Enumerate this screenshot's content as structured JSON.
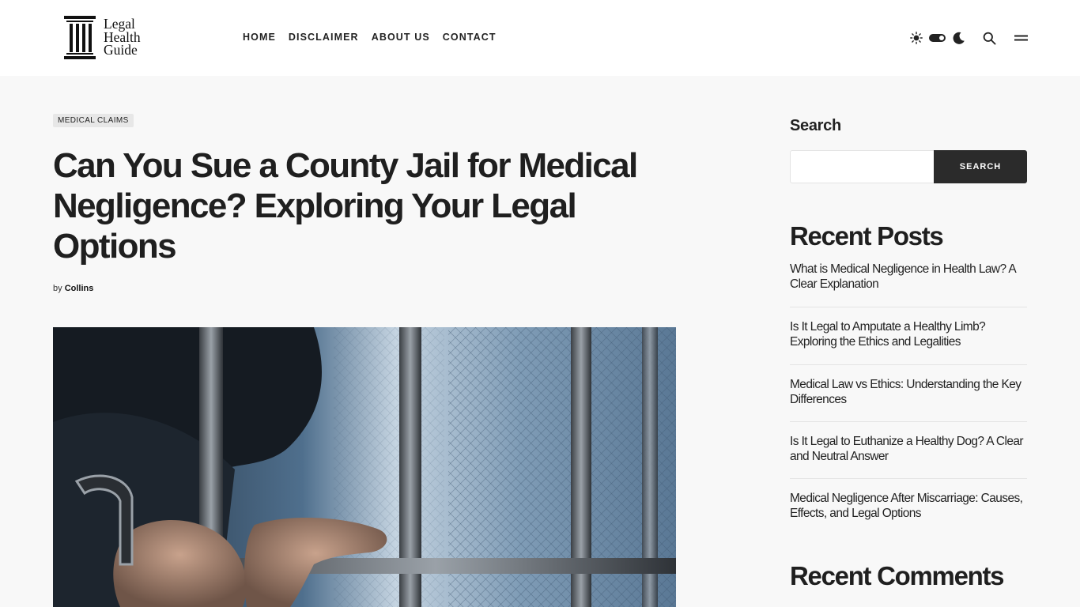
{
  "site": {
    "logo_lines": [
      "Legal",
      "Health",
      "Guide"
    ]
  },
  "nav": {
    "items": [
      "HOME",
      "DISCLAIMER",
      "ABOUT US",
      "CONTACT"
    ]
  },
  "header_tools": {
    "icons": [
      "sun-icon",
      "toggle-switch",
      "moon-icon",
      "search-icon",
      "hamburger-menu-icon"
    ]
  },
  "post": {
    "category": "MEDICAL CLAIMS",
    "title": "Can You Sue a County Jail for Medical Negligence? Exploring Your Legal Options",
    "by_label": "by",
    "author": "Collins"
  },
  "sidebar": {
    "search_title": "Search",
    "search_button": "SEARCH",
    "search_value": "",
    "recent_posts_title": "Recent Posts",
    "recent_posts": [
      "What is Medical Negligence in Health Law? A Clear Explanation",
      "Is It Legal to Amputate a Healthy Limb? Exploring the Ethics and Legalities",
      "Medical Law vs Ethics: Understanding the Key Differences",
      "Is It Legal to Euthanize a Healthy Dog? A Clear and Neutral Answer",
      "Medical Negligence After Miscarriage: Causes, Effects, and Legal Options"
    ],
    "recent_comments_title": "Recent Comments"
  },
  "colors": {
    "header_bg": "#ffffff",
    "page_bg": "#f8f8f8",
    "text": "#1f1f1f",
    "button_bg": "#2b2b2b",
    "badge_bg": "#e7e7e7"
  }
}
